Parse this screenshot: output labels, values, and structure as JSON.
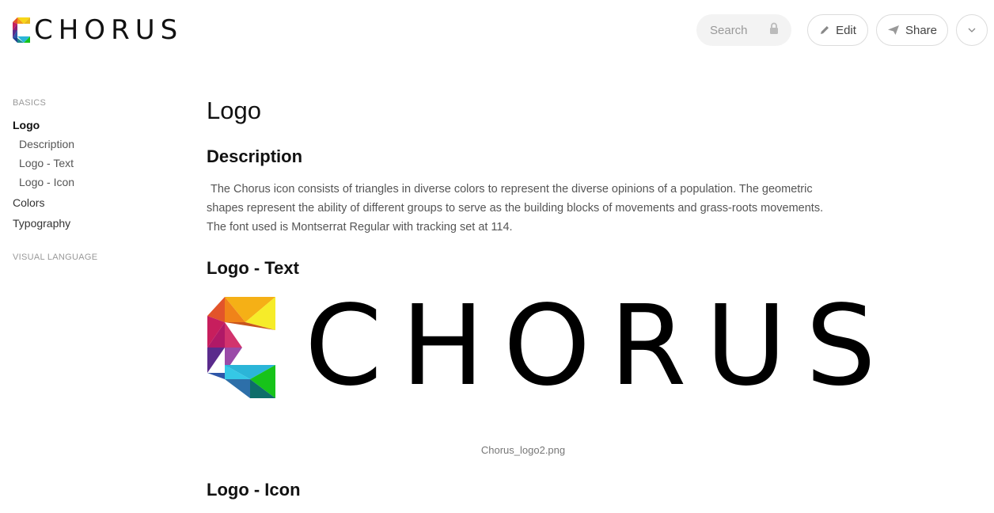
{
  "brand": {
    "name": "CHORUS"
  },
  "header": {
    "search_placeholder": "Search",
    "edit_label": "Edit",
    "share_label": "Share"
  },
  "sidebar": {
    "sections": [
      {
        "label": "BASICS",
        "items": [
          {
            "label": "Logo",
            "active": true
          },
          {
            "label": "Description"
          },
          {
            "label": "Logo  - Text"
          },
          {
            "label": "Logo  - Icon"
          },
          {
            "label": "Colors"
          },
          {
            "label": "Typography"
          }
        ]
      },
      {
        "label": "VISUAL LANGUAGE",
        "items": []
      }
    ]
  },
  "main": {
    "title": "Logo",
    "description": {
      "heading": "Description",
      "text": "The Chorus icon consists of triangles in diverse colors to represent the diverse opinions of a population. The geometric shapes represent the ability of different groups to serve as the building blocks of movements and grass-roots movements. The font used is Montserrat Regular with tracking set at 114."
    },
    "logo_text": {
      "heading": "Logo  - Text",
      "image_word": "CHORUS",
      "caption": "Chorus_logo2.png"
    },
    "logo_icon": {
      "heading": "Logo  - Icon"
    }
  },
  "colors": {
    "logo": [
      "#f7d619",
      "#f39a18",
      "#e2542a",
      "#c71e5d",
      "#8e1f74",
      "#5a2b8c",
      "#2e56a8",
      "#2bb5d8",
      "#35c8e6",
      "#1d8a8c",
      "#17c31a",
      "#0e6e6a"
    ]
  }
}
